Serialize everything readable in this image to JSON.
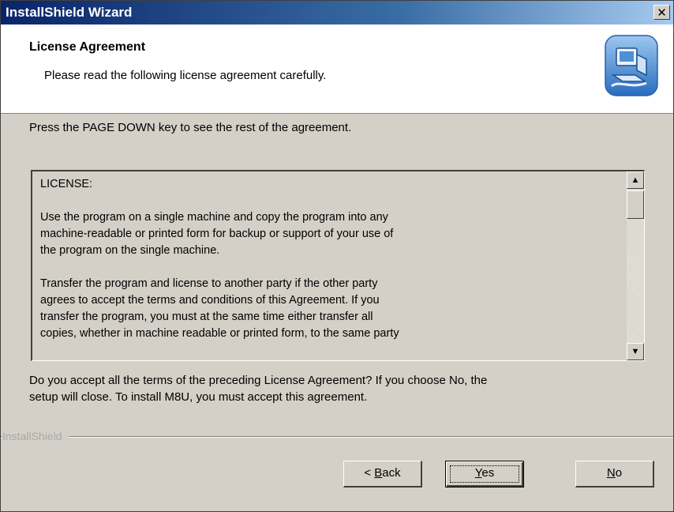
{
  "window": {
    "title": "InstallShield Wizard",
    "close_glyph": "✕"
  },
  "header": {
    "title": "License Agreement",
    "subtitle": "Please read the following license agreement carefully.",
    "icon": "computer-setup-icon"
  },
  "instruction": "Press the PAGE DOWN key to see the rest of the agreement.",
  "license": {
    "heading": "LICENSE:",
    "paragraphs": [
      {
        "lines": [
          "Use the program on a single machine and copy the program into any",
          "machine-readable or printed form for backup or support of your use of",
          "the program on the single machine."
        ]
      },
      {
        "lines": [
          "Transfer the program and license to another party if the other party",
          "agrees to accept the terms and conditions of this Agreement.  If you",
          "transfer the program, you must at the same time either transfer all",
          "copies, whether in machine readable or printed form, to the same party"
        ]
      }
    ],
    "scroll_up_glyph": "▲",
    "scroll_down_glyph": "▼"
  },
  "question": {
    "lines": [
      "Do you accept all the terms of the preceding License Agreement?  If you choose No,  the",
      "setup will close.  To install M8U, you must accept this agreement."
    ]
  },
  "brand": "InstallShield",
  "buttons": {
    "back": {
      "prefix": "< ",
      "mnemonic": "B",
      "rest": "ack"
    },
    "yes": {
      "prefix": "",
      "mnemonic": "Y",
      "rest": "es"
    },
    "no": {
      "prefix": "",
      "mnemonic": "N",
      "rest": "o"
    }
  },
  "colors": {
    "titlebar_start": "#0a246a",
    "titlebar_end": "#a6caf0",
    "face": "#d4d0c8",
    "brand_text": "#a8a8a8"
  }
}
